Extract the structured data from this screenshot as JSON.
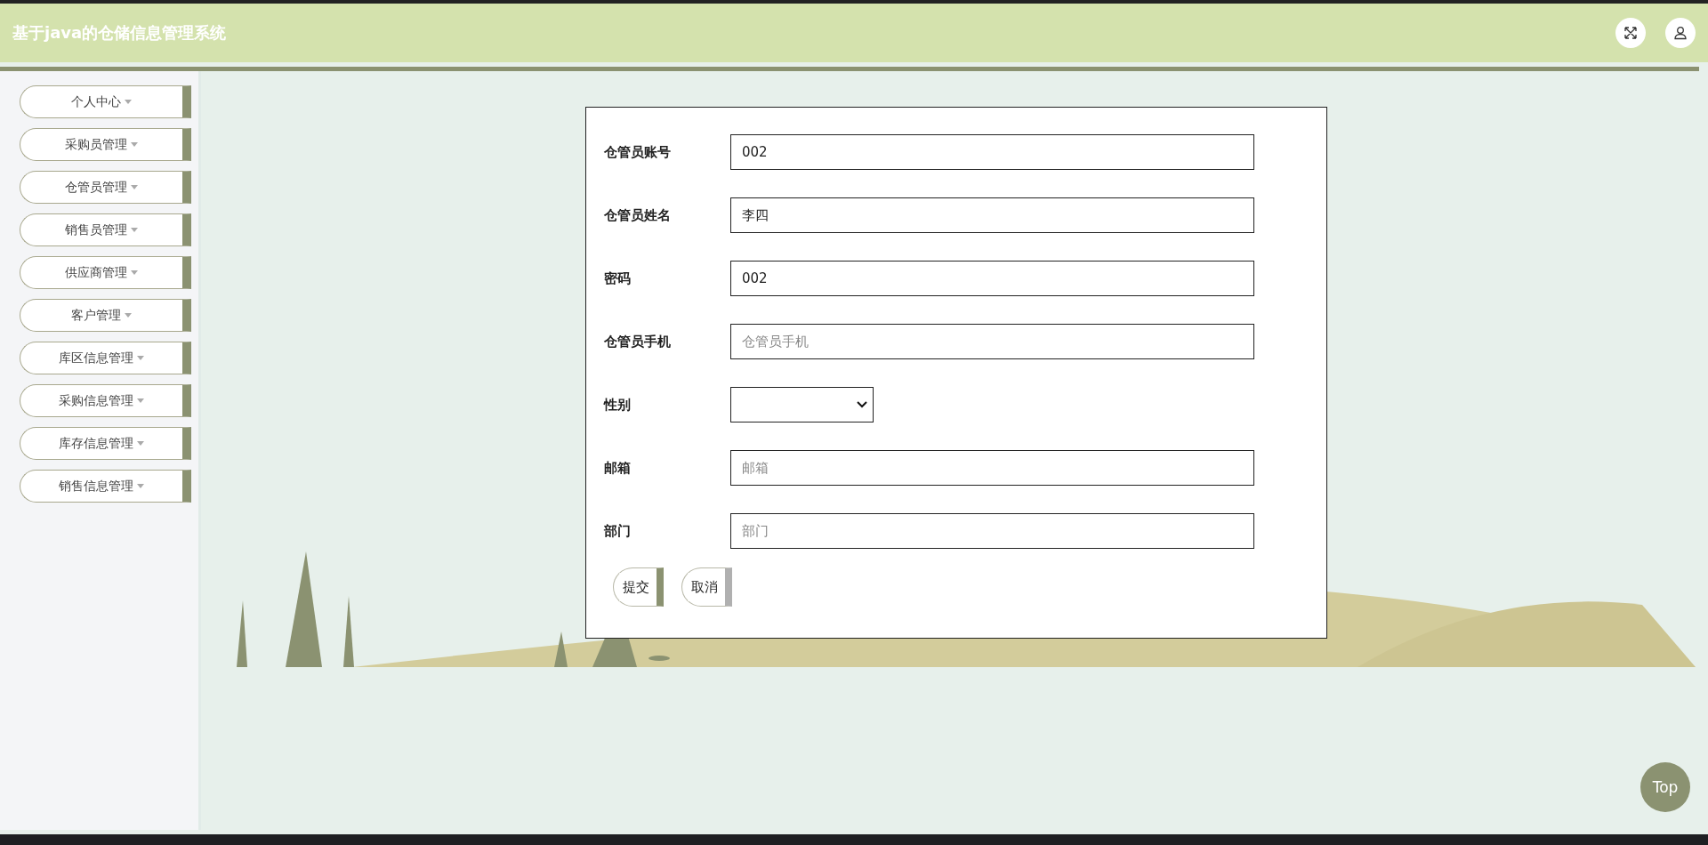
{
  "header": {
    "title": "基于java的仓储信息管理系统"
  },
  "sidebar": {
    "items": [
      {
        "label": "个人中心"
      },
      {
        "label": "采购员管理"
      },
      {
        "label": "仓管员管理"
      },
      {
        "label": "销售员管理"
      },
      {
        "label": "供应商管理"
      },
      {
        "label": "客户管理"
      },
      {
        "label": "库区信息管理"
      },
      {
        "label": "采购信息管理"
      },
      {
        "label": "库存信息管理"
      },
      {
        "label": "销售信息管理"
      }
    ]
  },
  "form": {
    "fields": [
      {
        "label": "仓管员账号",
        "kind": "text",
        "value": "002"
      },
      {
        "label": "仓管员姓名",
        "kind": "text",
        "value": "李四"
      },
      {
        "label": "密码",
        "kind": "text",
        "value": "002"
      },
      {
        "label": "仓管员手机",
        "kind": "text",
        "placeholder": "仓管员手机"
      },
      {
        "label": "性别",
        "kind": "select"
      },
      {
        "label": "邮箱",
        "kind": "text",
        "placeholder": "邮箱"
      },
      {
        "label": "部门",
        "kind": "text",
        "placeholder": "部门"
      }
    ],
    "buttons": [
      {
        "label": "提交",
        "kind": "primary"
      },
      {
        "label": "取消",
        "kind": "secondary"
      }
    ]
  },
  "back_to_top": "Top"
}
